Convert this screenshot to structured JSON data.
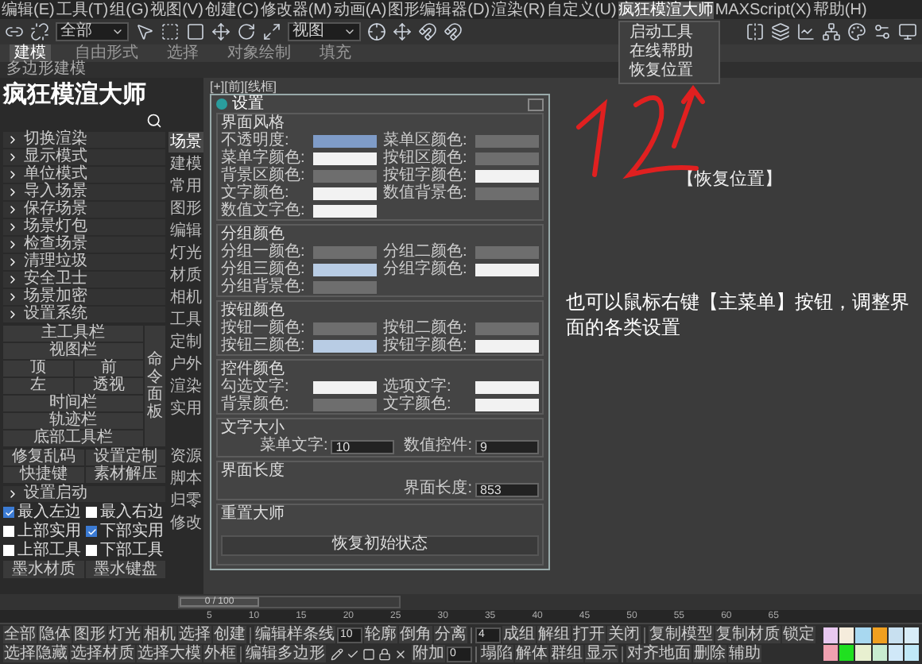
{
  "menu_bar": {
    "items": [
      {
        "label": "编辑(E)",
        "selected": false
      },
      {
        "label": "工具(T)",
        "selected": false
      },
      {
        "label": "组(G)",
        "selected": false
      },
      {
        "label": "视图(V)",
        "selected": false
      },
      {
        "label": "创建(C)",
        "selected": false
      },
      {
        "label": "修改器(M)",
        "selected": false
      },
      {
        "label": "动画(A)",
        "selected": false
      },
      {
        "label": "图形编辑器(D)",
        "selected": false
      },
      {
        "label": "渲染(R)",
        "selected": false
      },
      {
        "label": "自定义(U)",
        "selected": false
      },
      {
        "label": "疯狂模渲大师",
        "selected": true
      },
      {
        "label": "MAXScript(X)",
        "selected": false
      },
      {
        "label": "帮助(H)",
        "selected": false
      }
    ],
    "open_menu": [
      "启动工具",
      "在线帮助",
      "恢复位置"
    ]
  },
  "toolbar": {
    "selection_filter": "全部",
    "coordinate_system": "视图"
  },
  "ribbon": {
    "tabs": [
      {
        "label": "建模",
        "selected": true
      },
      {
        "label": "自由形式",
        "selected": false
      },
      {
        "label": "选择",
        "selected": false
      },
      {
        "label": "对象绘制",
        "selected": false
      },
      {
        "label": "填充",
        "selected": false
      }
    ],
    "sub_label": "多边形建模"
  },
  "panel": {
    "title": "疯狂模渲大师",
    "items": [
      "切换渲染",
      "显示模式",
      "单位模式",
      "导入场景",
      "保存场景",
      "场景灯包",
      "检查场景",
      "清理垃圾",
      "安全卫士",
      "场景加密",
      "设置系统"
    ],
    "layout_buttons": [
      [
        "主工具栏"
      ],
      [
        "视图栏"
      ],
      [
        "顶",
        "前"
      ],
      [
        "左",
        "透视"
      ],
      [
        "时间栏"
      ],
      [
        "轨迹栏"
      ],
      [
        "底部工具栏"
      ]
    ],
    "side_button": "命令面板",
    "extra_buttons": [
      [
        "修复乱码",
        "设置定制"
      ],
      [
        "快捷键",
        "素材解压"
      ]
    ],
    "startup_label": "设置启动",
    "checkboxes": [
      {
        "label": "最入左边",
        "checked": true
      },
      {
        "label": "最入右边",
        "checked": false
      },
      {
        "label": "上部实用",
        "checked": false
      },
      {
        "label": "下部实用",
        "checked": true
      },
      {
        "label": "上部工具",
        "checked": false
      },
      {
        "label": "下部工具",
        "checked": false
      }
    ],
    "bottom_buttons": [
      "墨水材质",
      "墨水键盘"
    ]
  },
  "side_tabs": [
    {
      "label": "场景",
      "selected": true
    },
    {
      "label": "建模",
      "selected": false
    },
    {
      "label": "常用",
      "selected": false
    },
    {
      "label": "图形",
      "selected": false
    },
    {
      "label": "编辑",
      "selected": false
    },
    {
      "label": "灯光",
      "selected": false
    },
    {
      "label": "材质",
      "selected": false
    },
    {
      "label": "相机",
      "selected": false
    },
    {
      "label": "工具",
      "selected": false
    },
    {
      "label": "定制",
      "selected": false
    },
    {
      "label": "户外",
      "selected": false
    },
    {
      "label": "渲染",
      "selected": false
    },
    {
      "label": "实用",
      "selected": false
    },
    {
      "label": "资源",
      "selected": false
    },
    {
      "label": "脚本",
      "selected": false
    },
    {
      "label": "归零",
      "selected": false
    },
    {
      "label": "修改",
      "selected": false
    }
  ],
  "viewport": {
    "label": "[+][前][线框]",
    "callout": "【恢复位置】",
    "note": "也可以鼠标右键【主菜单】按钮，调整界面的各类设置"
  },
  "settings_dialog": {
    "title": "设置",
    "color_groups": [
      {
        "title": "界面风格",
        "rows": [
          {
            "label": "不透明度:",
            "color": "#7f9cc8"
          },
          {
            "label": "菜单区颜色:",
            "color": "#6e6e6e"
          },
          {
            "label": "菜单字颜色:",
            "color": "#f2f2f2"
          },
          {
            "label": "按钮区颜色:",
            "color": "#6e6e6e"
          },
          {
            "label": "背景区颜色:",
            "color": "#6e6e6e"
          },
          {
            "label": "按钮字颜色:",
            "color": "#f2f2f2"
          },
          {
            "label": "文字颜色:",
            "color": "#f2f2f2"
          },
          {
            "label": "数值背景色:",
            "color": "#6e6e6e"
          },
          {
            "label": "数值文字色:",
            "color": "#f2f2f2"
          }
        ]
      },
      {
        "title": "分组颜色",
        "rows": [
          {
            "label": "分组一颜色:",
            "color": "#6e6e6e"
          },
          {
            "label": "分组二颜色:",
            "color": "#6e6e6e"
          },
          {
            "label": "分组三颜色:",
            "color": "#b8cce4"
          },
          {
            "label": "分组字颜色:",
            "color": "#f2f2f2"
          },
          {
            "label": "分组背景色:",
            "color": "#6e6e6e"
          }
        ]
      },
      {
        "title": "按钮颜色",
        "rows": [
          {
            "label": "按钮一颜色:",
            "color": "#6e6e6e"
          },
          {
            "label": "按钮二颜色:",
            "color": "#6e6e6e"
          },
          {
            "label": "按钮三颜色:",
            "color": "#b8cce4"
          },
          {
            "label": "按钮字颜色:",
            "color": "#f2f2f2"
          }
        ]
      },
      {
        "title": "控件颜色",
        "rows": [
          {
            "label": "勾选文字:",
            "color": "#f2f2f2"
          },
          {
            "label": "选项文字:",
            "color": "#f2f2f2"
          },
          {
            "label": "背景颜色:",
            "color": "#6e6e6e"
          },
          {
            "label": "文字颜色:",
            "color": "#f2f2f2"
          }
        ]
      }
    ],
    "number_groups": [
      {
        "title": "文字大小",
        "fields": [
          {
            "label": "菜单文字:",
            "value": "10"
          },
          {
            "label": "数值控件:",
            "value": "9"
          }
        ]
      },
      {
        "title": "界面长度",
        "fields": [
          {
            "label": "界面长度:",
            "value": "853"
          }
        ]
      }
    ],
    "reset": {
      "title": "重置大师",
      "button": "恢复初始状态"
    }
  },
  "timeline": {
    "label": "0 / 100",
    "level": 0,
    "ticks": [
      "5",
      "10",
      "15",
      "20",
      "25",
      "30",
      "35",
      "40",
      "45",
      "50",
      "55",
      "60",
      "65"
    ]
  },
  "bottom_toolbar": {
    "upper_row": [
      {
        "kind": "button",
        "label": "全部"
      },
      {
        "kind": "button",
        "label": "隐体"
      },
      {
        "kind": "button",
        "label": "图形"
      },
      {
        "kind": "button",
        "label": "灯光"
      },
      {
        "kind": "button",
        "label": "相机"
      },
      {
        "kind": "button",
        "label": "选择"
      },
      {
        "kind": "button",
        "label": "创建"
      },
      {
        "kind": "divider"
      },
      {
        "kind": "button",
        "label": "编辑样条线"
      },
      {
        "kind": "field",
        "value": "10"
      },
      {
        "kind": "button",
        "label": "轮廓"
      },
      {
        "kind": "button",
        "label": "倒角"
      },
      {
        "kind": "button",
        "label": "分离"
      },
      {
        "kind": "divider"
      },
      {
        "kind": "field",
        "value": "4"
      },
      {
        "kind": "button",
        "label": "成组"
      },
      {
        "kind": "button",
        "label": "解组"
      },
      {
        "kind": "button",
        "label": "打开"
      },
      {
        "kind": "button",
        "label": "关闭"
      },
      {
        "kind": "divider"
      },
      {
        "kind": "button",
        "label": "复制模型"
      },
      {
        "kind": "button",
        "label": "复制材质"
      },
      {
        "kind": "button",
        "label": "锁定"
      }
    ],
    "lower_row": [
      {
        "kind": "button",
        "label": "选择隐藏"
      },
      {
        "kind": "button",
        "label": "选择材质"
      },
      {
        "kind": "button",
        "label": "选择大模"
      },
      {
        "kind": "button",
        "label": "外框"
      },
      {
        "kind": "divider"
      },
      {
        "kind": "button",
        "label": "编辑多边形"
      },
      {
        "kind": "tools"
      },
      {
        "kind": "button",
        "label": "附加"
      },
      {
        "kind": "field",
        "value": "0"
      },
      {
        "kind": "divider"
      },
      {
        "kind": "button",
        "label": "塌陷"
      },
      {
        "kind": "button",
        "label": "解体"
      },
      {
        "kind": "button",
        "label": "群组"
      },
      {
        "kind": "button",
        "label": "显示"
      },
      {
        "kind": "divider"
      },
      {
        "kind": "button",
        "label": "对齐地面"
      },
      {
        "kind": "button",
        "label": "删除"
      },
      {
        "kind": "button",
        "label": "辅助"
      }
    ],
    "palette": [
      {
        "color": "#e8c8f0"
      },
      {
        "color": "#f5ecdc"
      },
      {
        "color": "#a8d8f0"
      },
      {
        "color": "#f0a020"
      },
      {
        "color": "#c8e0f0"
      },
      {
        "color": "#d8ecf8"
      },
      {
        "color": "#f0a0b0"
      },
      {
        "color": "#20e020"
      },
      {
        "color": "#e8f0d0"
      },
      {
        "color": "#c8ecd0"
      },
      {
        "color": "#d0e8f8"
      },
      {
        "color": "#c0e8f8"
      }
    ]
  }
}
